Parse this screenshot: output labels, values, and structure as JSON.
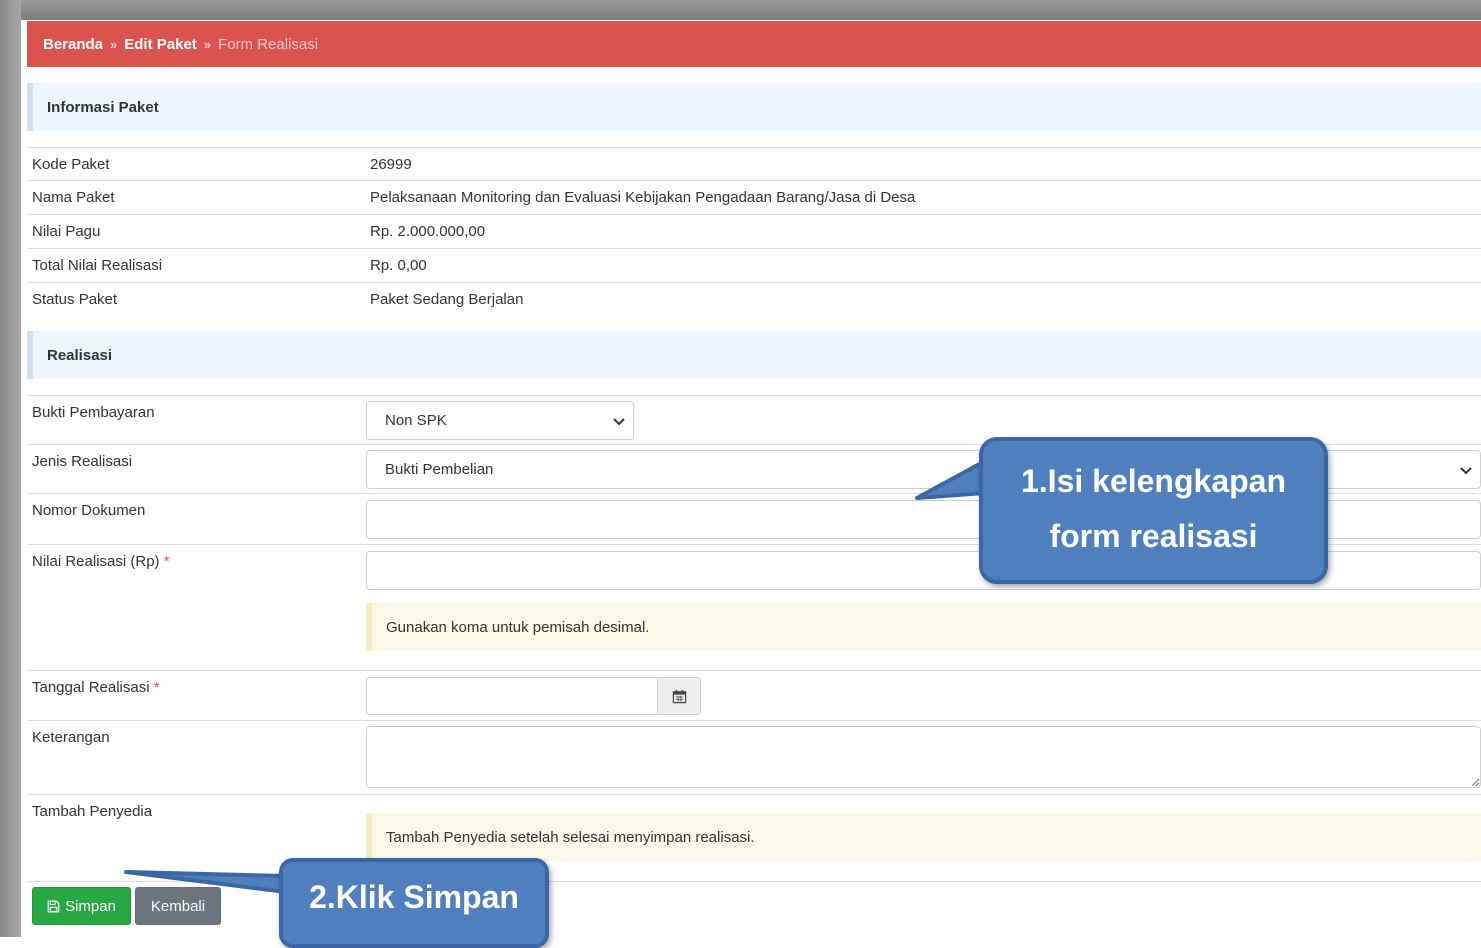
{
  "breadcrumb": {
    "home": "Beranda",
    "edit": "Edit Paket",
    "current": "Form Realisasi",
    "separator": "»"
  },
  "info_section": {
    "title": "Informasi Paket",
    "rows": [
      {
        "label": "Kode Paket",
        "value": "26999"
      },
      {
        "label": "Nama Paket",
        "value": "Pelaksanaan Monitoring dan Evaluasi Kebijakan Pengadaan Barang/Jasa di Desa"
      },
      {
        "label": "Nilai Pagu",
        "value": "Rp. 2.000.000,00"
      },
      {
        "label": "Total Nilai Realisasi",
        "value": "Rp. 0,00"
      },
      {
        "label": "Status Paket",
        "value": "Paket Sedang Berjalan"
      }
    ]
  },
  "realisasi_section": {
    "title": "Realisasi",
    "bukti_pembayaran": {
      "label": "Bukti Pembayaran",
      "value": "Non SPK"
    },
    "jenis_realisasi": {
      "label": "Jenis Realisasi",
      "value": "Bukti Pembelian"
    },
    "nomor_dokumen": {
      "label": "Nomor Dokumen",
      "value": ""
    },
    "nilai_realisasi": {
      "label": "Nilai Realisasi (Rp)",
      "required_mark": "*",
      "value": "",
      "note": "Gunakan koma untuk pemisah desimal."
    },
    "tanggal_realisasi": {
      "label": "Tanggal Realisasi",
      "required_mark": "*",
      "value": ""
    },
    "keterangan": {
      "label": "Keterangan",
      "value": ""
    },
    "tambah_penyedia": {
      "label": "Tambah Penyedia",
      "note": "Tambah Penyedia setelah selesai menyimpan realisasi."
    }
  },
  "buttons": {
    "save": "Simpan",
    "back": "Kembali"
  },
  "annotations": {
    "callout1_line1": "1.Isi kelengkapan",
    "callout1_line2": "form realisasi",
    "callout2": "2.Klik Simpan"
  },
  "colors": {
    "breadcrumb": "#db534f",
    "section": "#eef5fb",
    "note": "#fcf8e8",
    "save": "#28a745",
    "back": "#6c757d",
    "callout": "#4f7fbc"
  }
}
